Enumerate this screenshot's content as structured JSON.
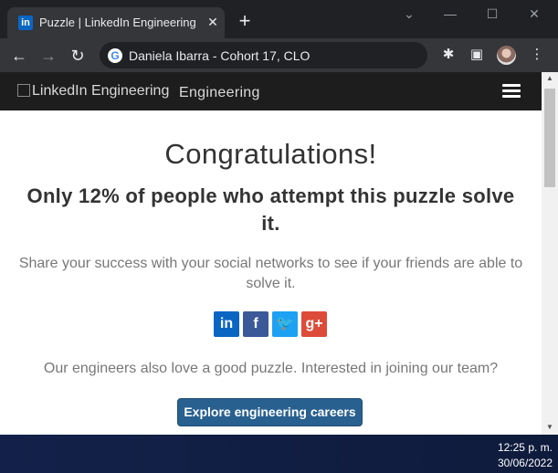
{
  "browser": {
    "tab_title": "Puzzle | LinkedIn Engineering",
    "tab_favicon": "in",
    "address_text": "Daniela Ibarra - Cohort 17, CLO"
  },
  "site": {
    "logo_alt": "LinkedIn Engineering",
    "logo_suffix": "Engineering"
  },
  "content": {
    "headline": "Congratulations!",
    "subheadline": "Only 12% of people who attempt this puzzle solve it.",
    "share_text": "Share your success with your social networks to see if your friends are able to solve it.",
    "social": [
      {
        "label": "in",
        "icon": "linkedin-icon",
        "color": "#0a66c2"
      },
      {
        "label": "f",
        "icon": "facebook-icon",
        "color": "#3b5998"
      },
      {
        "label": "🐦",
        "icon": "twitter-icon",
        "color": "#1da1f2"
      },
      {
        "label": "g+",
        "icon": "googleplus-icon",
        "color": "#dd4b39"
      }
    ],
    "engineers_text": "Our engineers also love a good puzzle. Interested in joining our team?",
    "cta_label": "Explore engineering careers"
  },
  "taskbar": {
    "time": "12:25 p. m.",
    "date": "30/06/2022"
  }
}
